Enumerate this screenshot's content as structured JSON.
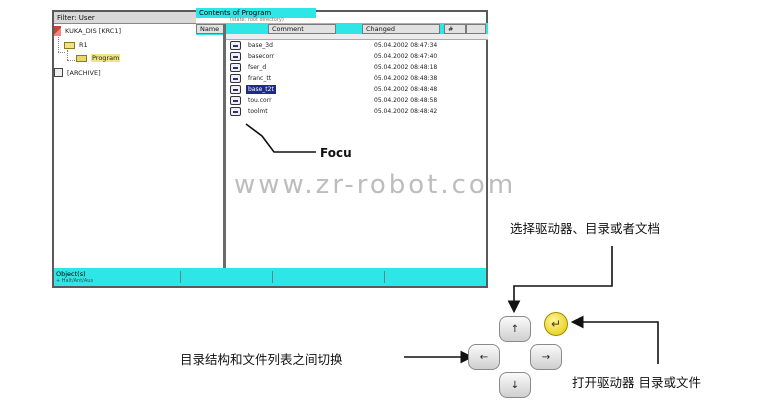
{
  "screen": {
    "filter_label": "Filter: User",
    "title": "Contents of Program",
    "subtitle": "(state: root directory)",
    "columns": [
      "Name",
      "Comment",
      "Changed",
      "#"
    ],
    "tree": {
      "root": "KUKA_DIS [KRC1]",
      "r1": "R1",
      "program": "Program",
      "archive": "[ARCHIVE]"
    },
    "files": [
      {
        "name": "base_3d",
        "date": "05.04.2002 08:47:34"
      },
      {
        "name": "basecorr",
        "date": "05.04.2002 08:47:40"
      },
      {
        "name": "fser_d",
        "date": "05.04.2002 08:48:18"
      },
      {
        "name": "franc_tt",
        "date": "05.04.2002 08:48:38"
      },
      {
        "name": "base_t2t",
        "date": "05.04.2002 08:48:48"
      },
      {
        "name": "tou.corr",
        "date": "05.04.2002 08:48:58"
      },
      {
        "name": "toolmt",
        "date": "05.04.2002 08:48:42"
      }
    ],
    "selected_index": 4,
    "status_label": "Object(s)",
    "status_sub": "+ Halt/Ant/Aus"
  },
  "annotations": {
    "focus": "Focu",
    "watermark": "www.zr-robot.com",
    "select_hint": "选择驱动器、目录或者文档",
    "switch_hint": "目录结构和文件列表之间切换",
    "open_hint": "打开驱动器 目录或文件"
  },
  "keys": {
    "up": "↑",
    "down": "↓",
    "left": "←",
    "right": "→",
    "enter": "↵"
  },
  "colors": {
    "accent_cyan": "#2ee6e6",
    "selection": "#1e2a88",
    "enter_key": "#e2c800"
  }
}
